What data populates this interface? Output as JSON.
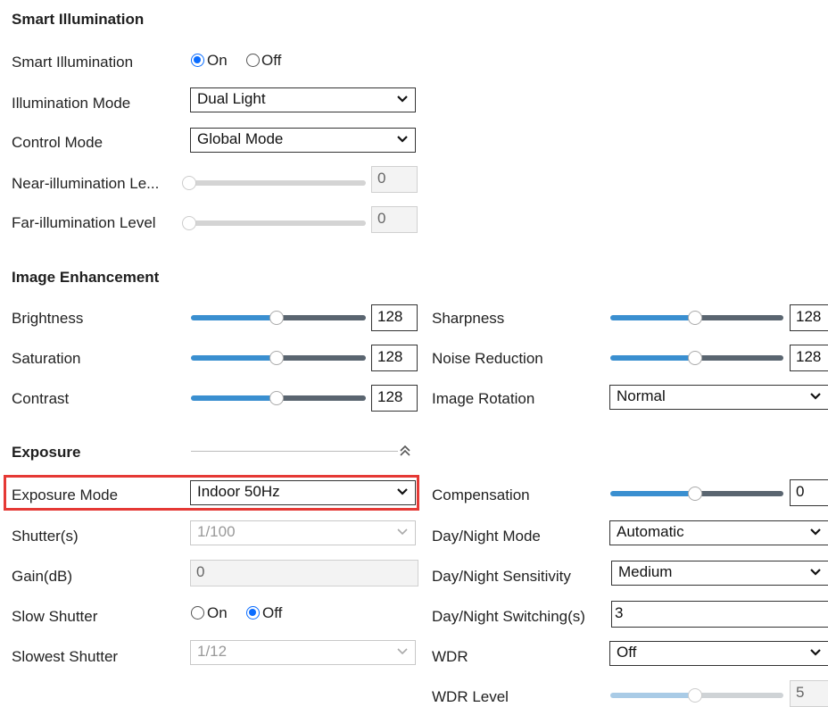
{
  "smart_illumination": {
    "heading": "Smart Illumination",
    "smart_illumination_label": "Smart Illumination",
    "on_label": "On",
    "off_label": "Off",
    "selected": "On",
    "illumination_mode_label": "Illumination Mode",
    "illumination_mode_value": "Dual Light",
    "control_mode_label": "Control Mode",
    "control_mode_value": "Global Mode",
    "near_label": "Near-illumination Le...",
    "near_value": "0",
    "far_label": "Far-illumination Level",
    "far_value": "0"
  },
  "image_enhancement": {
    "heading": "Image Enhancement",
    "brightness_label": "Brightness",
    "brightness_value": "128",
    "saturation_label": "Saturation",
    "saturation_value": "128",
    "contrast_label": "Contrast",
    "contrast_value": "128",
    "sharpness_label": "Sharpness",
    "sharpness_value": "128",
    "noise_label": "Noise Reduction",
    "noise_value": "128",
    "rotation_label": "Image Rotation",
    "rotation_value": "Normal"
  },
  "exposure": {
    "heading": "Exposure",
    "exposure_mode_label": "Exposure Mode",
    "exposure_mode_value": "Indoor 50Hz",
    "shutter_label": "Shutter(s)",
    "shutter_value": "1/100",
    "gain_label": "Gain(dB)",
    "gain_value": "0",
    "slow_shutter_label": "Slow Shutter",
    "slow_on_label": "On",
    "slow_off_label": "Off",
    "slow_selected": "Off",
    "slowest_label": "Slowest Shutter",
    "slowest_value": "1/12",
    "compensation_label": "Compensation",
    "compensation_value": "0",
    "daynight_mode_label": "Day/Night Mode",
    "daynight_mode_value": "Automatic",
    "daynight_sens_label": "Day/Night Sensitivity",
    "daynight_sens_value": "Medium",
    "daynight_switch_label": "Day/Night Switching(s)",
    "daynight_switch_value": "3",
    "wdr_label": "WDR",
    "wdr_value": "Off",
    "wdr_level_label": "WDR Level",
    "wdr_level_value": "5"
  },
  "colors": {
    "accent_blue": "#0a6cff",
    "slider_left": "#3a8fd0",
    "slider_right": "#5a6570",
    "highlight_red": "#e53935"
  }
}
